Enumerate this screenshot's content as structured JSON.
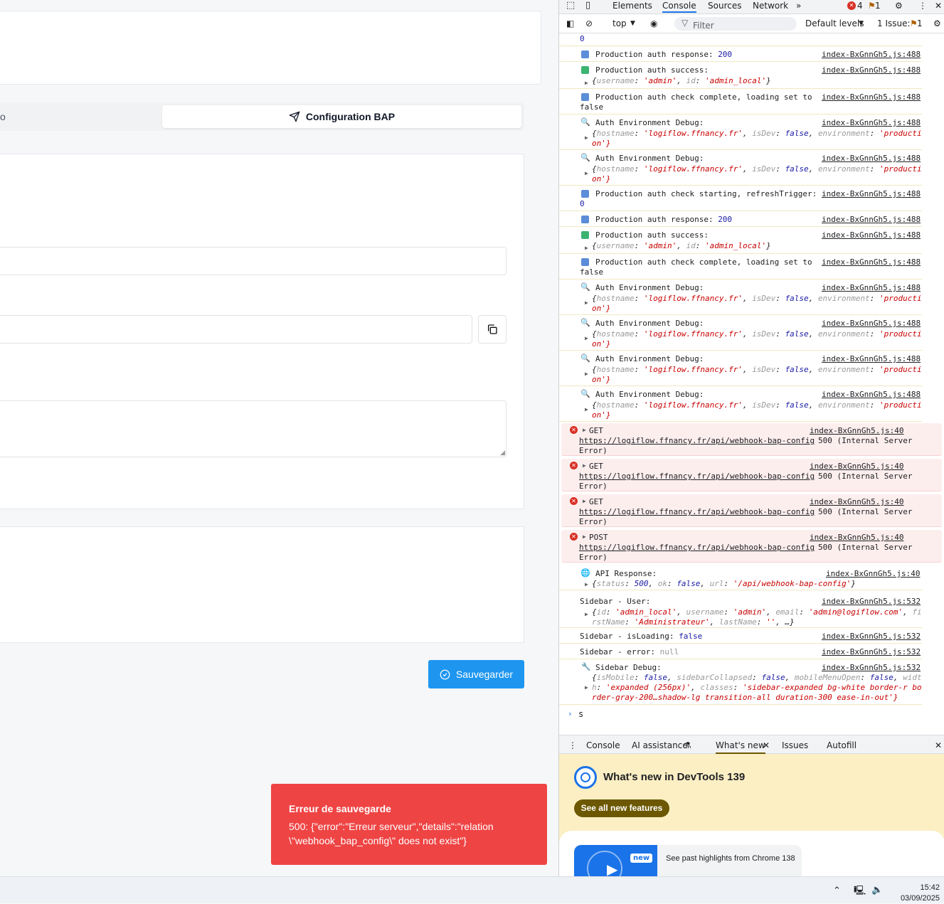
{
  "app": {
    "tab_partial": "o",
    "tab_active": "Configuration BAP",
    "save_label": "Sauvegarder",
    "toast": {
      "title": "Erreur de sauvegarde",
      "message": "500: {\"error\":\"Erreur serveur\",\"details\":\"relation \\\"webhook_bap_config\\\" does not exist\"}"
    }
  },
  "devtools": {
    "tabs": [
      "Elements",
      "Console",
      "Sources",
      "Network"
    ],
    "active_tab": "Console",
    "error_count": "4",
    "issue_count_top": "1",
    "toolbar": {
      "context": "top",
      "filter_placeholder": "Filter",
      "levels": "Default levels",
      "issues": "1 Issue:",
      "issues_count": "1"
    },
    "console_first": "0",
    "prompt_text": "s",
    "drawer": {
      "tabs": [
        "Console",
        "AI assistance",
        "What's new",
        "Issues",
        "Autofill"
      ],
      "whatsnew_title": "What's new in DevTools 139",
      "see_all": "See all new features",
      "new_badge": "new",
      "highlights": "See past highlights from Chrome 138"
    },
    "source_488": "index-BxGnnGh5.js:488",
    "source_40": "index-BxGnnGh5.js:40",
    "source_532": "index-BxGnnGh5.js:532",
    "api_url": "https://logiflow.ffnancy.fr/api/webhook-bap-config"
  },
  "taskbar": {
    "time": "15:42",
    "date": "03/09/2025"
  }
}
